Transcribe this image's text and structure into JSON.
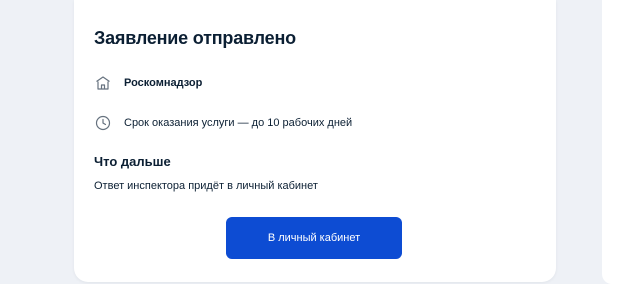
{
  "card": {
    "title": "Заявление отправлено",
    "organization": {
      "icon": "building-icon",
      "name": "Роскомнадзор"
    },
    "service_term": {
      "icon": "clock-icon",
      "text": "Срок оказания услуги — до 10 рабочих дней"
    },
    "next_steps": {
      "heading": "Что дальше",
      "text": "Ответ инспектора придёт в личный кабинет"
    },
    "cabinet_button_label": "В личный кабинет"
  },
  "colors": {
    "page_background": "#eef1f6",
    "card_background": "#ffffff",
    "text": "#0b1f33",
    "icon": "#66727f",
    "button_background": "#0d4cd3",
    "button_text": "#ffffff"
  }
}
